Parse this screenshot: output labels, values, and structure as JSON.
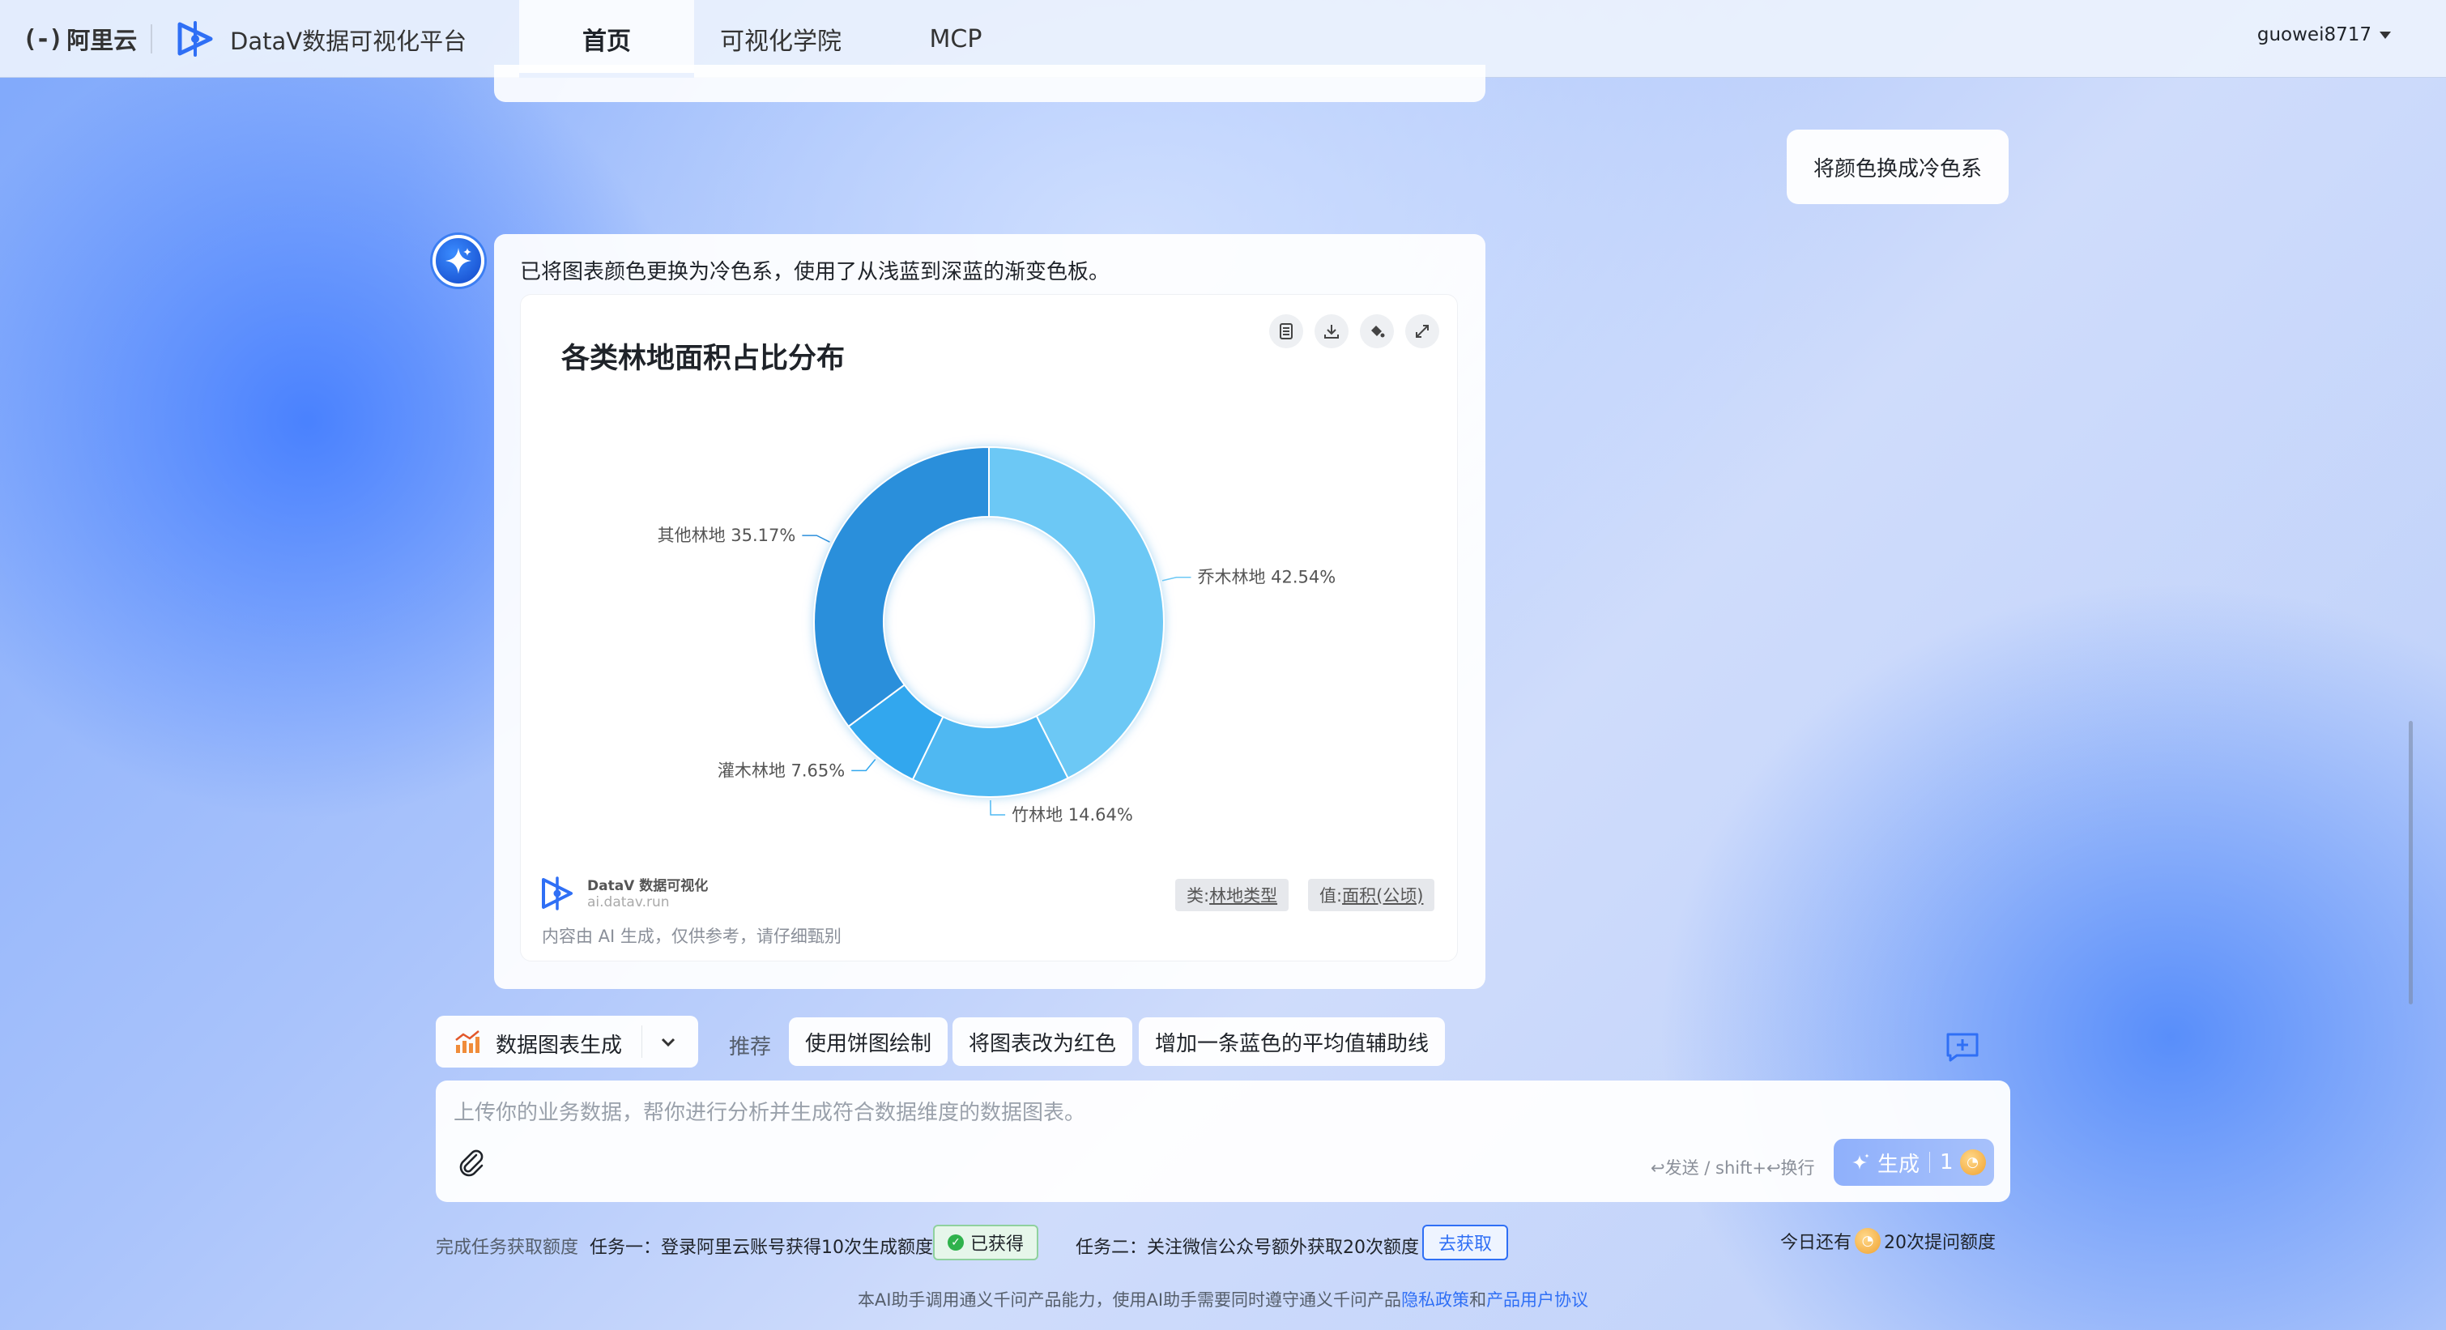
{
  "nav": {
    "aliyun_mark": "(-)",
    "aliyun_text": "阿里云",
    "platform_title": "DataV数据可视化平台",
    "tabs": [
      {
        "label": "首页",
        "active": true
      },
      {
        "label": "可视化学院",
        "active": false
      },
      {
        "label": "MCP",
        "active": false
      }
    ],
    "username": "guowei8717"
  },
  "chat": {
    "user_message": "将颜色换成冷色系",
    "ai_message": "已将图表颜色更换为冷色系，使用了从浅蓝到深蓝的渐变色板。",
    "toolbar_icons": [
      "table-icon",
      "download-icon",
      "paint-bucket-icon",
      "expand-icon"
    ],
    "watermark": {
      "name": "DataV 数据可视化",
      "url": "ai.datav.run"
    },
    "disclaimer": "内容由 AI 生成，仅供参考，请仔细甄别",
    "dimension_tags": {
      "category_prefix": "类: ",
      "category_field": "林地类型",
      "value_prefix": "值: ",
      "value_field": "面积(公顷)"
    }
  },
  "chart_data": {
    "type": "pie",
    "variant": "donut",
    "title": "各类林地面积占比分布",
    "slices": [
      {
        "label": "乔木林地",
        "percent": 42.54,
        "display": "乔木林地 42.54%",
        "color": "#6cc8f5"
      },
      {
        "label": "竹林地",
        "percent": 14.64,
        "display": "竹林地 14.64%",
        "color": "#4fb8f2"
      },
      {
        "label": "灌木林地",
        "percent": 7.65,
        "display": "灌木林地 7.65%",
        "color": "#32a7ee"
      },
      {
        "label": "其他林地",
        "percent": 35.17,
        "display": "其他林地 35.17%",
        "color": "#2b8fdb"
      }
    ],
    "start_angle_deg": 0,
    "direction": "clockwise",
    "legend": "none",
    "labels": "outside-with-leader-lines"
  },
  "composer": {
    "mode_label": "数据图表生成",
    "recommend_label": "推荐",
    "suggestions": [
      "使用饼图绘制",
      "将图表改为红色",
      "增加一条蓝色的平均值辅助线"
    ],
    "placeholder": "上传你的业务数据，帮你进行分析并生成符合数据维度的数据图表。",
    "send_hint": "↩发送 / shift+↩换行",
    "generate_label": "生成",
    "generate_cost": "1"
  },
  "tasks": {
    "intro": "完成任务获取额度",
    "task1": "任务一：登录阿里云账号获得10次生成额度",
    "task1_status": "已获得",
    "task2": "任务二：关注微信公众号额外获取20次额度",
    "task2_action": "去获取",
    "quota_prefix": "今日还有",
    "quota_value": "20次提问额度"
  },
  "footer": {
    "text": "本AI助手调用通义千问产品能力，使用AI助手需要同时遵守通义千问产品",
    "privacy_link": "隐私政策",
    "and": "和",
    "agreement_link": "产品用户协议"
  },
  "colors": {
    "accent": "#2f6ff5",
    "success": "#2fb24c"
  }
}
